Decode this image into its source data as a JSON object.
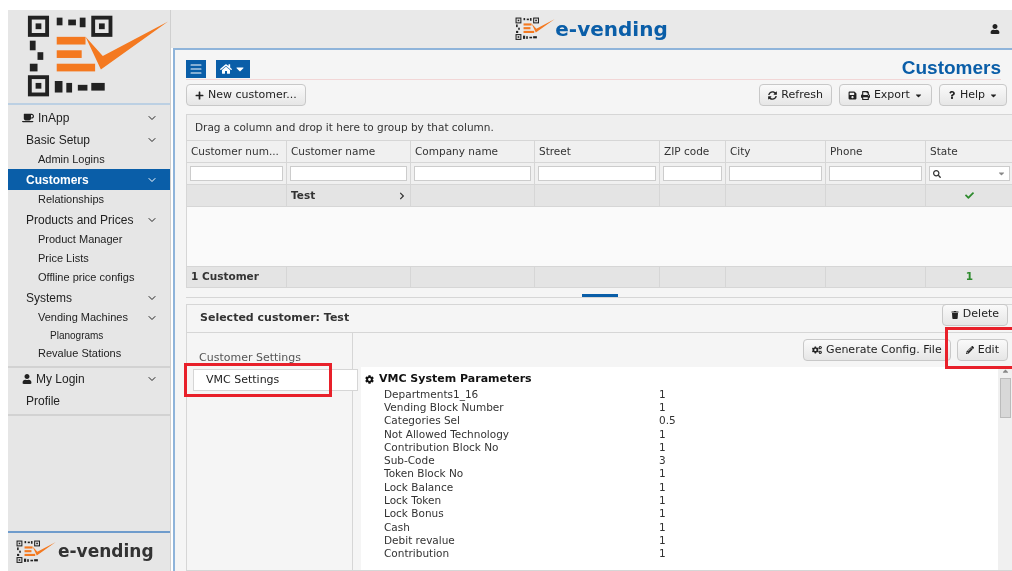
{
  "header": {
    "brand": "e-vending"
  },
  "sidebar": {
    "items": [
      {
        "label": "InApp",
        "expanded": true,
        "selected": false,
        "children": [
          {
            "label": "Basic Setup",
            "expanded": true,
            "selected": false,
            "children": [
              {
                "label": "Admin Logins",
                "selected": false
              }
            ]
          },
          {
            "label": "Customers",
            "expanded": true,
            "selected": true,
            "children": [
              {
                "label": "Relationships",
                "selected": false
              }
            ]
          },
          {
            "label": "Products and Prices",
            "expanded": true,
            "selected": false,
            "children": [
              {
                "label": "Product Manager",
                "selected": false
              },
              {
                "label": "Price Lists",
                "selected": false
              },
              {
                "label": "Offline price configs",
                "selected": false
              }
            ]
          },
          {
            "label": "Systems",
            "expanded": true,
            "selected": false,
            "children": [
              {
                "label": "Vending Machines",
                "expanded": true,
                "selected": false,
                "children": [
                  {
                    "label": "Planograms",
                    "selected": false
                  }
                ]
              },
              {
                "label": "Revalue Stations",
                "selected": false
              }
            ]
          }
        ]
      },
      {
        "label": "My Login",
        "expanded": true,
        "selected": false,
        "children": [
          {
            "label": "Profile",
            "selected": false
          }
        ]
      }
    ],
    "footer_brand": "e-vending"
  },
  "page": {
    "title": "Customers"
  },
  "toolbar": {
    "new_button": "New customer...",
    "buttons": [
      {
        "kind": "refresh",
        "label": "Refresh"
      },
      {
        "kind": "export",
        "label": "Export"
      },
      {
        "kind": "help",
        "label": "Help"
      }
    ]
  },
  "grid": {
    "group_hint": "Drag a column and drop it here to group by that column.",
    "columns": [
      {
        "label": "Customer num..."
      },
      {
        "label": "Customer name"
      },
      {
        "label": "Company name"
      },
      {
        "label": "Street"
      },
      {
        "label": "ZIP code"
      },
      {
        "label": "City"
      },
      {
        "label": "Phone"
      },
      {
        "label": "State"
      }
    ],
    "rows": [
      {
        "customer_name": "Test",
        "active": true
      }
    ],
    "footer": {
      "count": "1 Customer",
      "state_total": "1"
    }
  },
  "detail": {
    "title": "Selected customer: Test",
    "delete_button": "Delete",
    "tabs": [
      {
        "label": "Customer Settings",
        "selected": false,
        "annotated": false
      },
      {
        "label": "VMC Settings",
        "selected": true,
        "annotated": true
      }
    ],
    "generate_button": "Generate Config. File",
    "edit_button": {
      "label": "Edit",
      "annotated": true
    },
    "section_title": "VMC System Parameters",
    "parameters": [
      {
        "name": "Departments1_16",
        "value": "1"
      },
      {
        "name": "Vending Block Number",
        "value": "1"
      },
      {
        "name": "Categories Sel",
        "value": "0.5"
      },
      {
        "name": "Not Allowed Technology",
        "value": "1"
      },
      {
        "name": "Contribution Block No",
        "value": "1"
      },
      {
        "name": "Sub-Code",
        "value": "3"
      },
      {
        "name": "Token Block No",
        "value": "1"
      },
      {
        "name": "Lock Balance",
        "value": "1"
      },
      {
        "name": "Lock Token",
        "value": "1"
      },
      {
        "name": "Lock Bonus",
        "value": "1"
      },
      {
        "name": "Cash",
        "value": "1"
      },
      {
        "name": "Debit revalue",
        "value": "1"
      },
      {
        "name": "Contribution",
        "value": "1"
      }
    ]
  }
}
